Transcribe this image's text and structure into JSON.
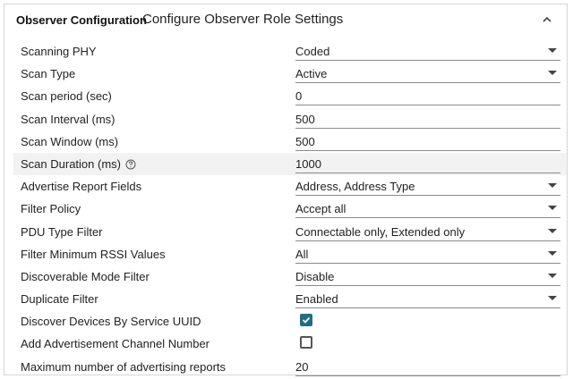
{
  "header": {
    "group": "Observer Configuration",
    "title": "Configure Observer Role Settings"
  },
  "accent_color": "#1f6e83",
  "rows": [
    {
      "label": "Scanning PHY",
      "type": "select",
      "value": "Coded"
    },
    {
      "label": "Scan Type",
      "type": "select",
      "value": "Active"
    },
    {
      "label": "Scan period (sec)",
      "type": "text",
      "value": "0"
    },
    {
      "label": "Scan Interval (ms)",
      "type": "text",
      "value": "500"
    },
    {
      "label": "Scan Window (ms)",
      "type": "text",
      "value": "500"
    },
    {
      "label": "Scan Duration (ms)",
      "type": "text",
      "value": "1000",
      "help_icon": "help-circle-icon",
      "highlighted": true
    },
    {
      "label": "Advertise Report Fields",
      "type": "select",
      "value": "Address, Address Type"
    },
    {
      "label": "Filter Policy",
      "type": "select",
      "value": "Accept all"
    },
    {
      "label": "PDU Type Filter",
      "type": "select",
      "value": "Connectable only, Extended only"
    },
    {
      "label": "Filter Minimum RSSI Values",
      "type": "select",
      "value": "All"
    },
    {
      "label": "Discoverable Mode Filter",
      "type": "select",
      "value": "Disable"
    },
    {
      "label": "Duplicate Filter",
      "type": "select",
      "value": "Enabled"
    },
    {
      "label": "Discover Devices By Service UUID",
      "type": "checkbox",
      "checked": true
    },
    {
      "label": "Add Advertisement Channel Number",
      "type": "checkbox",
      "checked": false
    },
    {
      "label": "Maximum number of advertising reports",
      "type": "text",
      "value": "20"
    }
  ]
}
